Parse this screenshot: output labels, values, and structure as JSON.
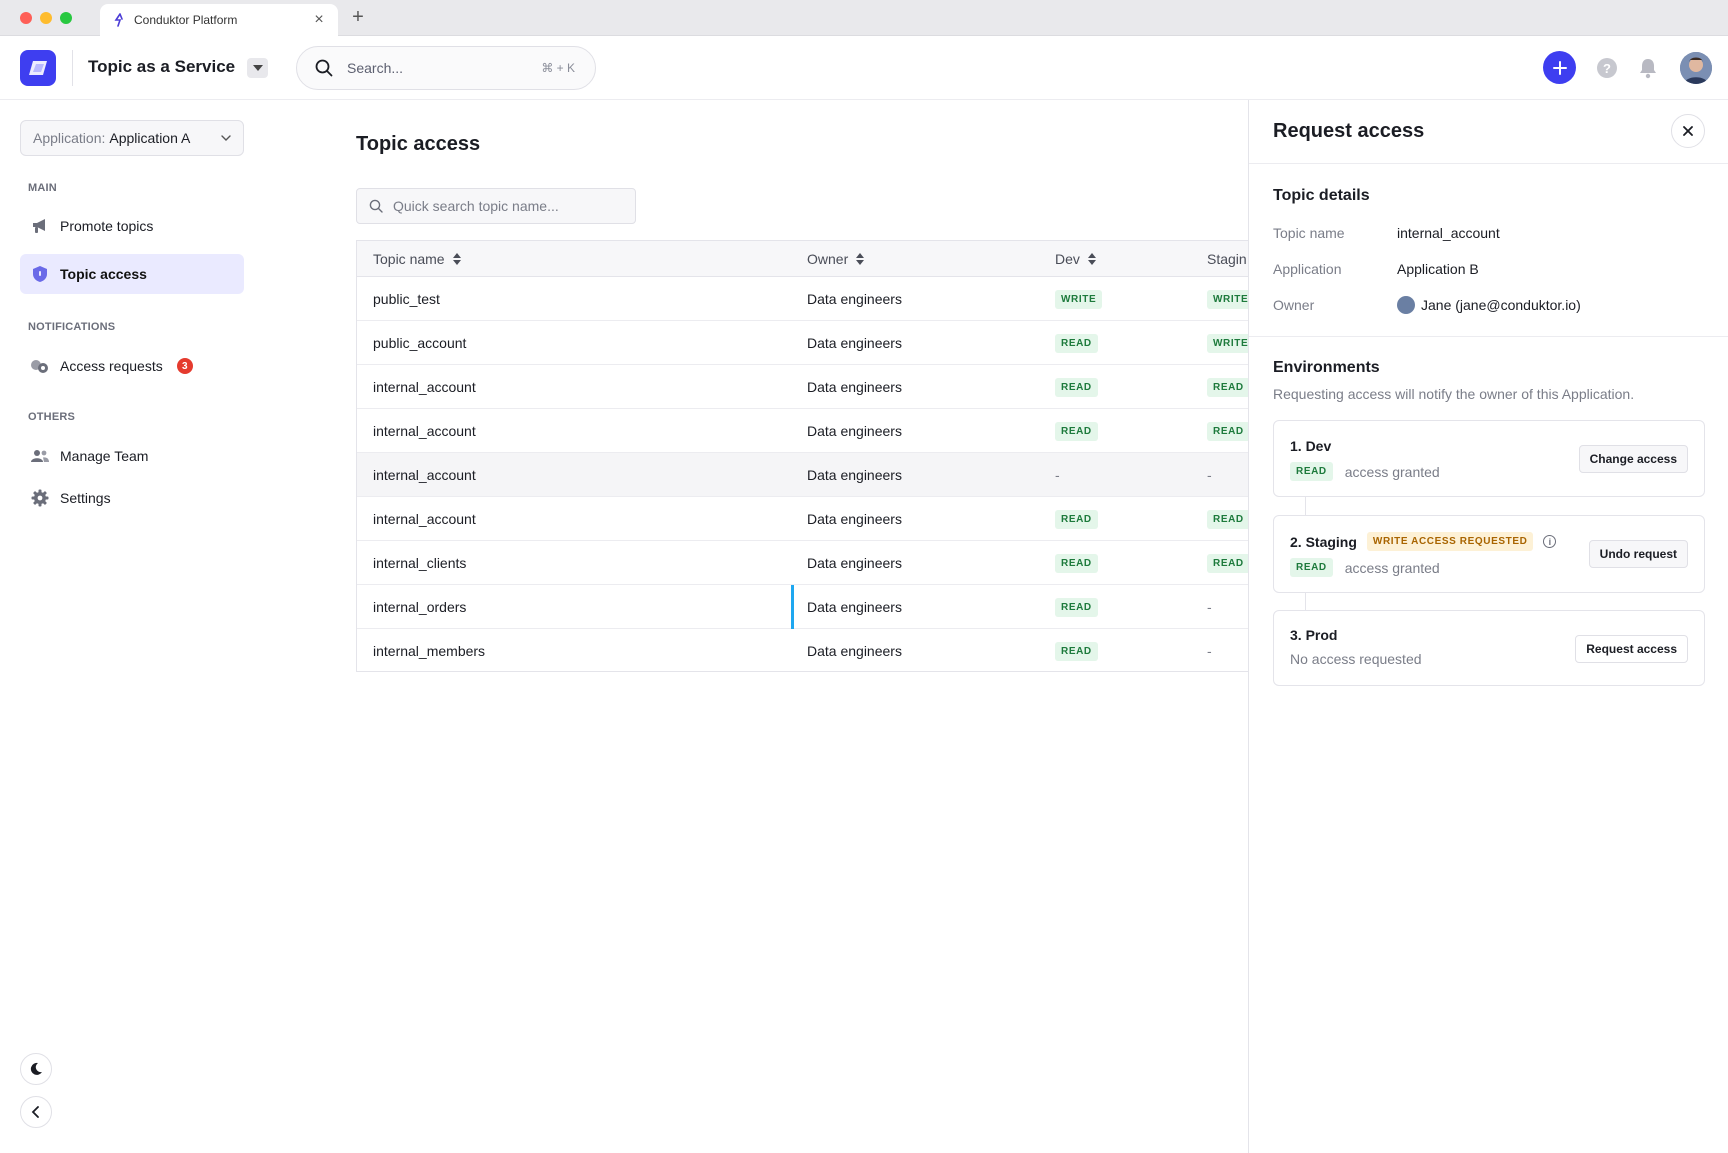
{
  "browser": {
    "tab_title": "Conduktor Platform",
    "close_glyph": "×",
    "new_tab_glyph": "+"
  },
  "topbar": {
    "title": "Topic as a Service",
    "search_placeholder": "Search...",
    "search_shortcut": "⌘ + K",
    "accent_color": "#3e3ef0"
  },
  "sidebar": {
    "app_select": {
      "prefix": "Application:",
      "value": "Application A"
    },
    "sections": {
      "main": "MAIN",
      "notifications": "NOTIFICATIONS",
      "others": "OTHERS"
    },
    "items": {
      "promote_topics": "Promote topics",
      "topic_access": "Topic access",
      "access_requests": "Access requests",
      "access_requests_count": "3",
      "manage_team": "Manage Team",
      "settings": "Settings"
    }
  },
  "main": {
    "title": "Topic access",
    "search_placeholder": "Quick search topic name...",
    "columns": {
      "topic": "Topic name",
      "owner": "Owner",
      "dev": "Dev",
      "staging": "Stagin"
    },
    "rows": [
      {
        "topic": "public_test",
        "owner": "Data engineers",
        "dev": "WRITE",
        "staging": "WRITE"
      },
      {
        "topic": "public_account",
        "owner": "Data engineers",
        "dev": "READ",
        "staging": "WRITE"
      },
      {
        "topic": "internal_account",
        "owner": "Data engineers",
        "dev": "READ",
        "staging": "READ"
      },
      {
        "topic": "internal_account",
        "owner": "Data engineers",
        "dev": "READ",
        "staging": "READ"
      },
      {
        "topic": "internal_account",
        "owner": "Data engineers",
        "dev": "-",
        "staging": "-"
      },
      {
        "topic": "internal_account",
        "owner": "Data engineers",
        "dev": "READ",
        "staging": "READ"
      },
      {
        "topic": "internal_clients",
        "owner": "Data engineers",
        "dev": "READ",
        "staging": "READ"
      },
      {
        "topic": "internal_orders",
        "owner": "Data engineers",
        "dev": "READ",
        "staging": "-"
      },
      {
        "topic": "internal_members",
        "owner": "Data engineers",
        "dev": "READ",
        "staging": "-"
      }
    ]
  },
  "drawer": {
    "title": "Request access",
    "details": {
      "heading": "Topic details",
      "topic_label": "Topic name",
      "topic_value": "internal_account",
      "application_label": "Application",
      "application_value": "Application B",
      "owner_label": "Owner",
      "owner_value": "Jane (jane@conduktor.io)"
    },
    "environments": {
      "heading": "Environments",
      "subtitle": "Requesting access will notify the owner of this Application.",
      "dev": {
        "name": "1. Dev",
        "permission": "READ",
        "status": "access granted",
        "button": "Change access"
      },
      "staging": {
        "name": "2. Staging",
        "request_badge": "WRITE ACCESS REQUESTED",
        "info_glyph": "i",
        "permission": "READ",
        "status": "access granted",
        "button": "Undo request"
      },
      "prod": {
        "name": "3. Prod",
        "status": "No access requested",
        "button": "Request access"
      }
    }
  }
}
